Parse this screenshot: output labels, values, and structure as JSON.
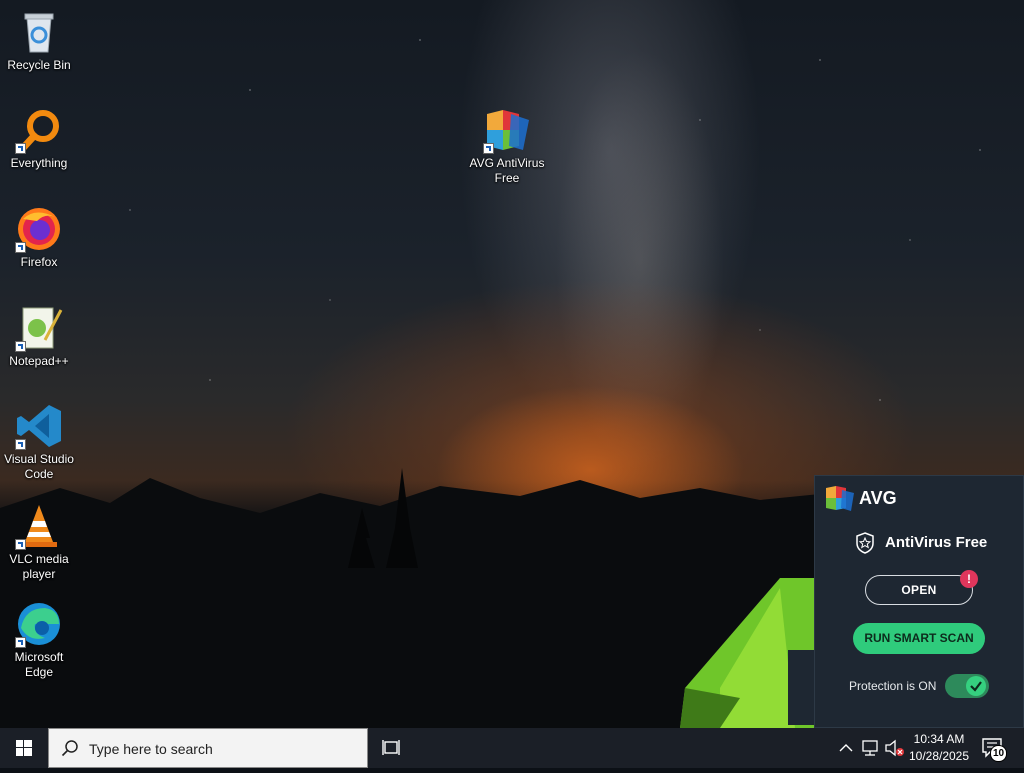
{
  "desktop": {
    "icons": [
      {
        "label": "Recycle Bin"
      },
      {
        "label": "Everything"
      },
      {
        "label": "Firefox"
      },
      {
        "label": "Notepad++"
      },
      {
        "label": "Visual Studio Code"
      },
      {
        "label": "VLC media player"
      },
      {
        "label": "Microsoft Edge"
      },
      {
        "label": "AVG AntiVirus Free"
      }
    ]
  },
  "taskbar": {
    "search_placeholder": "Type here to search",
    "clock_time": "10:34 AM",
    "clock_date": "10/28/2025",
    "notification_count": "10"
  },
  "avg_popup": {
    "brand": "AVG",
    "product": "AntiVirus Free",
    "open_label": "OPEN",
    "alert_symbol": "!",
    "scan_label": "RUN SMART SCAN",
    "protection_label": "Protection is ON",
    "protection_on": true
  },
  "colors": {
    "avg_green": "#2fcb7c",
    "avg_alert": "#e0365c",
    "avg_panel_bg": "#1e2732",
    "taskbar_bg": "#1b1f27"
  },
  "icons": [
    "windows-start-icon",
    "search-icon",
    "task-view-icon",
    "chevron-up-icon",
    "network-icon",
    "volume-muted-icon",
    "notification-icon",
    "shield-star-icon",
    "checkmark-icon"
  ]
}
